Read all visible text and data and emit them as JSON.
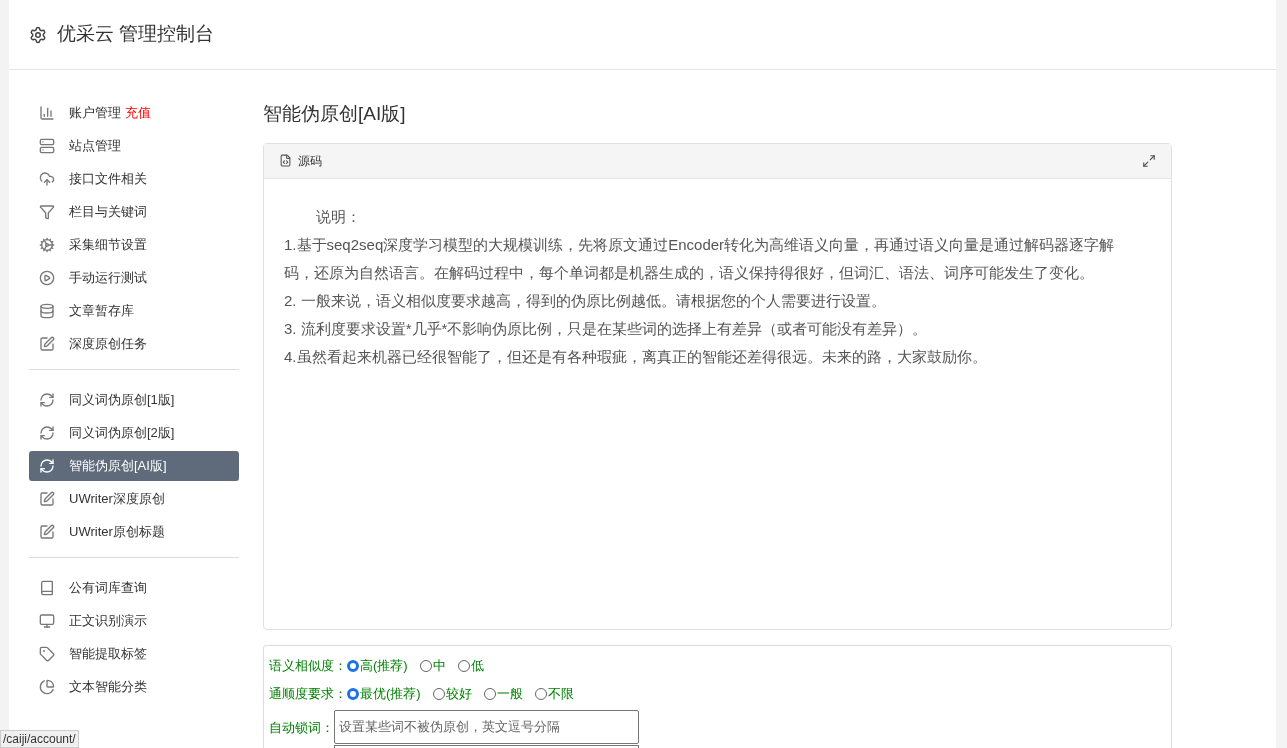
{
  "header": {
    "title": "优采云 管理控制台"
  },
  "sidebar": {
    "groups": [
      [
        {
          "label": "账户管理",
          "badge": "充值",
          "selected": false
        },
        {
          "label": "站点管理",
          "selected": false
        },
        {
          "label": "接口文件相关",
          "selected": false
        },
        {
          "label": "栏目与关键词",
          "selected": false
        },
        {
          "label": "采集细节设置",
          "selected": false
        },
        {
          "label": "手动运行测试",
          "selected": false
        },
        {
          "label": "文章暂存库",
          "selected": false
        },
        {
          "label": "深度原创任务",
          "selected": false
        }
      ],
      [
        {
          "label": "同义词伪原创[1版]",
          "selected": false
        },
        {
          "label": "同义词伪原创[2版]",
          "selected": false
        },
        {
          "label": "智能伪原创[AI版]",
          "selected": true
        },
        {
          "label": "UWriter深度原创",
          "selected": false
        },
        {
          "label": "UWriter原创标题",
          "selected": false
        }
      ],
      [
        {
          "label": "公有词库查询",
          "selected": false
        },
        {
          "label": "正文识别演示",
          "selected": false
        },
        {
          "label": "智能提取标签",
          "selected": false
        },
        {
          "label": "文本智能分类",
          "selected": false
        }
      ]
    ]
  },
  "page_title": "智能伪原创[AI版]",
  "panel": {
    "title": "源码",
    "heading": "说明：",
    "lines": [
      "1.基于seq2seq深度学习模型的大规模训练，先将原文通过Encoder转化为高维语义向量，再通过语义向量是通过解码器逐字解码，还原为自然语言。在解码过程中，每个单词都是机器生成的，语义保持得很好，但词汇、语法、词序可能发生了变化。",
      "2. 一般来说，语义相似度要求越高，得到的伪原比例越低。请根据您的个人需要进行设置。",
      "3. 流利度要求设置*几乎*不影响伪原比例，只是在某些词的选择上有差异（或者可能没有差异）。",
      "4.虽然看起来机器已经很智能了，但还是有各种瑕疵，离真正的智能还差得很远。未来的路，大家鼓励你。"
    ]
  },
  "form": {
    "similarity": {
      "label": "语义相似度：",
      "options": [
        {
          "label": "高(推荐)",
          "selected": true
        },
        {
          "label": "中",
          "selected": false
        },
        {
          "label": "低",
          "selected": false
        }
      ]
    },
    "fluency": {
      "label": "通顺度要求：",
      "options": [
        {
          "label": "最优(推荐)",
          "selected": true
        },
        {
          "label": "较好",
          "selected": false
        },
        {
          "label": "一般",
          "selected": false
        },
        {
          "label": "不限",
          "selected": false
        }
      ]
    },
    "lock_words": {
      "label": "自动锁词：",
      "placeholder": "设置某些词不被伪原创，英文逗号分隔"
    }
  },
  "status_url": "/caiji/account/"
}
